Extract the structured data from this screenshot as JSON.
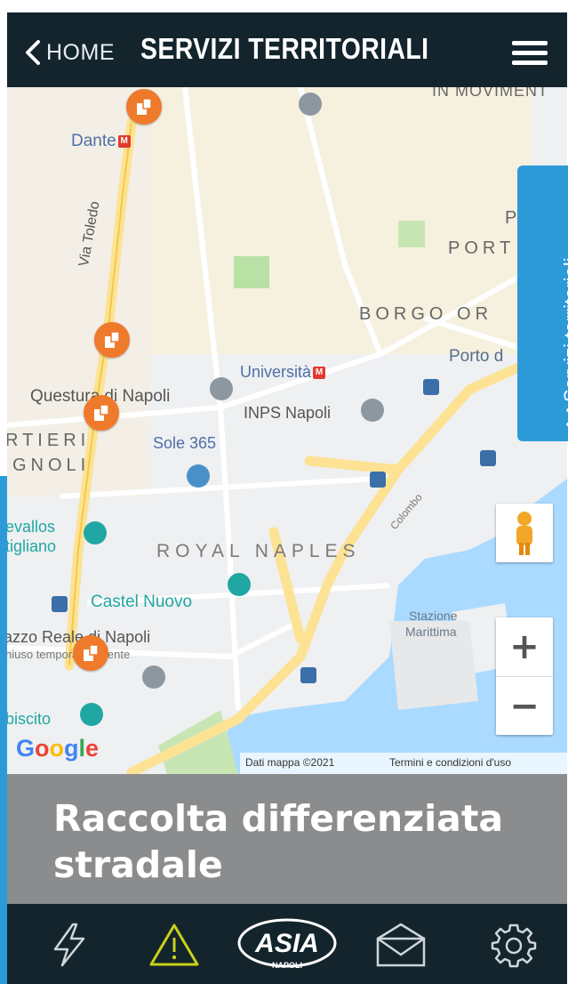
{
  "header": {
    "back_label": "HOME",
    "title": "SERVIZI TERRITORIALI",
    "icons": {
      "back": "chevron-left-icon",
      "menu": "hamburger-menu-icon"
    }
  },
  "map": {
    "labels": {
      "dante": "Dante",
      "via_toledo": "Via Toledo",
      "universita": "Università",
      "questura": "Questura di Napoli",
      "inps": "INPS Napoli",
      "rtieri": "RTIERI",
      "gnoli": "GNOLI",
      "sole365": "Sole 365",
      "vallos": "evallos",
      "tigliano": "tigliano",
      "royal_naples": "ROYAL NAPLES",
      "castel_nuovo": "Castel Nuovo",
      "palazzo_reale": "azzo Reale di Napoli",
      "palazzo_reale_sub": "hiuso temporaneamente",
      "plebiscito": "biscito",
      "stazione": "Stazione",
      "marittima": "Marittima",
      "porto": "Porto d",
      "borgo": "BORGO OR",
      "port": "PORT",
      "movimento": "IN MOVIMENT",
      "colombo": "Colombo",
      "p_letter": "P"
    },
    "metro_badge": "M",
    "google_logo": "Google",
    "attribution": "Dati mappa ©2021",
    "terms": "Termini e condizioni d'uso",
    "zoom_in": "+",
    "zoom_out": "−",
    "pegman_icon": "pegman-street-view-icon",
    "pin_icon": "recycling-bin-pin-icon",
    "colors": {
      "pin": "#ef7a2c",
      "road": "#fde293",
      "water": "#aadaff",
      "park": "#c8e6b4",
      "poi_blue": "#4a90c8",
      "poi_teal": "#21a7a3",
      "poi_grey": "#8c97a0"
    }
  },
  "side_tab": {
    "label": "Servizi territoriali",
    "icon": "chevron-right-icon"
  },
  "banner": {
    "line1": "Raccolta differenziata",
    "line2": "stradale"
  },
  "tabbar": {
    "items": [
      {
        "icon": "lightning-icon"
      },
      {
        "icon": "warning-triangle-icon"
      },
      {
        "icon": "asia-napoli-logo",
        "logo_text": "ASIA",
        "logo_sub": "NAPOLI"
      },
      {
        "icon": "envelope-icon"
      },
      {
        "icon": "gear-icon"
      }
    ]
  },
  "theme": {
    "dark": "#13242c",
    "blue": "#2d9ad8",
    "banner": "#8a8c8e",
    "warning": "#c9d11a"
  }
}
